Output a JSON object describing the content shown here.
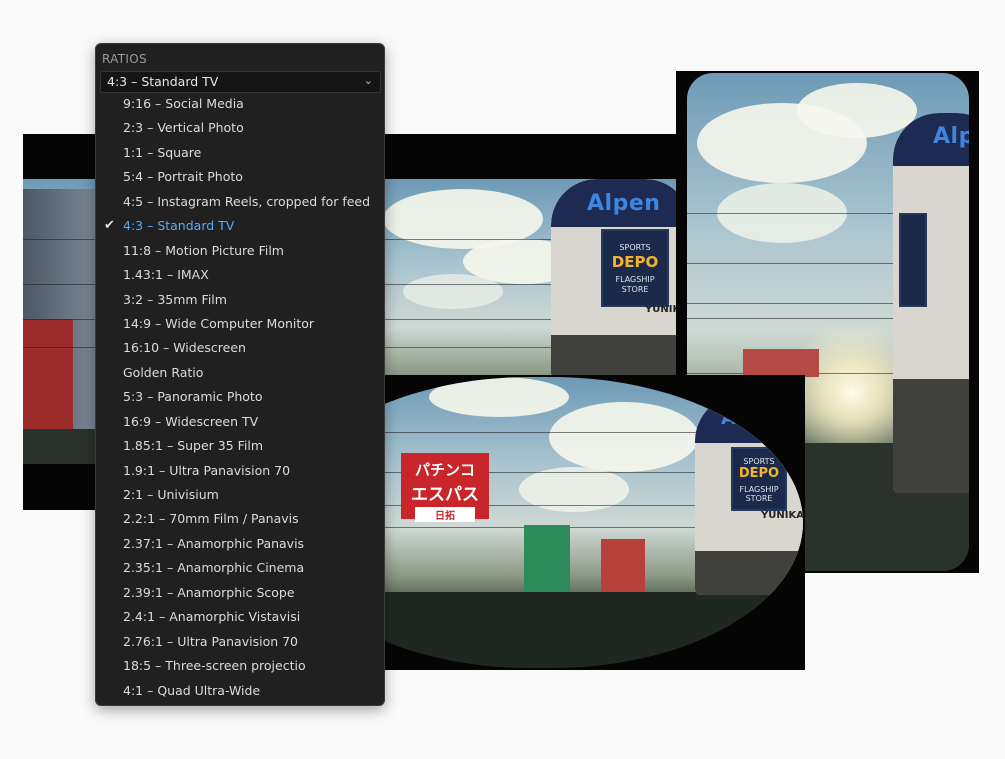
{
  "ratios_menu": {
    "header": "RATIOS",
    "selected_value": "4:3 – Standard TV",
    "options": [
      {
        "label": "9:16 – Social Media",
        "checked": false
      },
      {
        "label": "2:3 – Vertical Photo",
        "checked": false
      },
      {
        "label": "1:1 – Square",
        "checked": false
      },
      {
        "label": "5:4 – Portrait Photo",
        "checked": false
      },
      {
        "label": "4:5 – Instagram Reels, cropped for feed",
        "checked": false
      },
      {
        "label": "4:3 – Standard TV",
        "checked": true
      },
      {
        "label": "11:8 – Motion Picture Film",
        "checked": false
      },
      {
        "label": "1.43:1 – IMAX",
        "checked": false
      },
      {
        "label": "3:2 – 35mm Film",
        "checked": false
      },
      {
        "label": "14:9 – Wide Computer Monitor",
        "checked": false
      },
      {
        "label": "16:10 – Widescreen",
        "checked": false
      },
      {
        "label": "Golden Ratio",
        "checked": false
      },
      {
        "label": "5:3 – Panoramic Photo",
        "checked": false
      },
      {
        "label": "16:9 – Widescreen TV",
        "checked": false
      },
      {
        "label": "1.85:1 – Super 35 Film",
        "checked": false
      },
      {
        "label": "1.9:1 – Ultra Panavision 70",
        "checked": false
      },
      {
        "label": "2:1 – Univisium",
        "checked": false
      },
      {
        "label": "2.2:1 – 70mm Film / Panavis",
        "checked": false
      },
      {
        "label": "2.37:1 – Anamorphic Panavis",
        "checked": false
      },
      {
        "label": "2.35:1 – Anamorphic Cinema",
        "checked": false
      },
      {
        "label": "2.39:1 – Anamorphic Scope",
        "checked": false
      },
      {
        "label": "2.4:1 – Anamorphic Vistavisi",
        "checked": false
      },
      {
        "label": "2.76:1 – Ultra Panavision 70",
        "checked": false
      },
      {
        "label": "18:5 – Three-screen projectio",
        "checked": false
      },
      {
        "label": "4:1 – Quad Ultra-Wide",
        "checked": false
      }
    ],
    "accent_color": "#5aa9ff",
    "icons": {
      "check": "checkmark-icon",
      "dropdown": "chevron-down-icon"
    }
  },
  "photo_signs": {
    "alpen": "Alpen",
    "sports": "SPORTS",
    "depo": "DEPO",
    "flagship": "FLAGSHIP",
    "store": "STORE",
    "yunika": "YUNIKA",
    "pachinko": "パチンコ",
    "espace": "エスパス",
    "bottom": "日拓"
  }
}
